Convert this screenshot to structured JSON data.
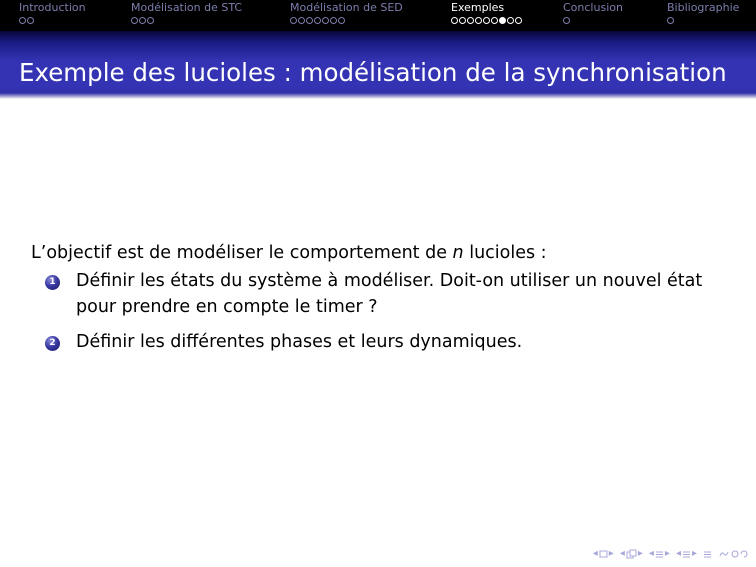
{
  "navbar": {
    "sections": [
      {
        "title": "Introduction",
        "dots": 2,
        "filled_index": -1,
        "active": false
      },
      {
        "title": "Modélisation de STC",
        "dots": 3,
        "filled_index": -1,
        "active": false
      },
      {
        "title": "Modélisation de SED",
        "dots": 7,
        "filled_index": -1,
        "active": false
      },
      {
        "title": "Exemples",
        "dots": 9,
        "filled_index": 6,
        "active": true
      },
      {
        "title": "Conclusion",
        "dots": 1,
        "filled_index": -1,
        "active": false
      },
      {
        "title": "Bibliographie",
        "dots": 1,
        "filled_index": -1,
        "active": false
      }
    ]
  },
  "frame": {
    "title": "Exemple des lucioles : modélisation de la synchronisation"
  },
  "content": {
    "intro_before": "L’objectif est de modéliser le comportement de ",
    "intro_var": "n",
    "intro_after": " lucioles :",
    "items": [
      {
        "number": "1",
        "text": "Définir les états du système à modéliser. Doit-on utiliser un nouvel état pour prendre en compte le timer ?"
      },
      {
        "number": "2",
        "text": "Définir les différentes phases et leurs dynamiques."
      }
    ]
  },
  "colors": {
    "navbar_bg": "#000000",
    "nav_inactive": "#7d7dad",
    "nav_active": "#ffffff",
    "title_band": "#3333b3",
    "nav_symbols": "#a8a8d8"
  },
  "bottom_nav": {
    "icons": [
      "frame-nav-icon",
      "subsection-nav-icon",
      "section-nav-icon",
      "presentation-nav-icon",
      "align-icon",
      "search-icon"
    ]
  }
}
